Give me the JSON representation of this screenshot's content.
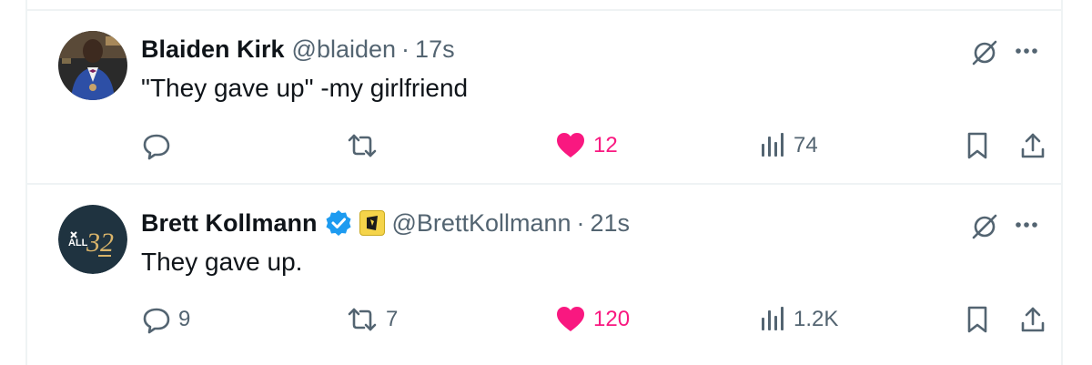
{
  "tweets": [
    {
      "author": {
        "name": "Blaiden Kirk",
        "handle": "@blaiden"
      },
      "separator": "·",
      "time": "17s",
      "text": "\"They gave up\" -my girlfriend",
      "stats": {
        "replies": "",
        "reposts": "",
        "likes": "12",
        "views": "74"
      },
      "liked": true
    },
    {
      "author": {
        "name": "Brett Kollmann",
        "handle": "@BrettKollmann",
        "verified": true,
        "affiliate_badge": true
      },
      "separator": "·",
      "time": "21s",
      "text": "They gave up.",
      "stats": {
        "replies": "9",
        "reposts": "7",
        "likes": "120",
        "views": "1.2K"
      },
      "liked": true,
      "avatar_logo": {
        "top": "ALL",
        "number": "32"
      }
    }
  ],
  "colors": {
    "like": "#f91880",
    "muted": "#536471",
    "verified": "#1d9bf0",
    "avatar2_bg": "#1f3340",
    "avatar2_accent": "#d9b46a"
  },
  "icons": [
    "grok-icon",
    "more-icon",
    "reply-icon",
    "repost-icon",
    "heart-icon",
    "views-icon",
    "bookmark-icon",
    "share-icon",
    "verified-badge-icon",
    "affiliate-badge-icon"
  ]
}
